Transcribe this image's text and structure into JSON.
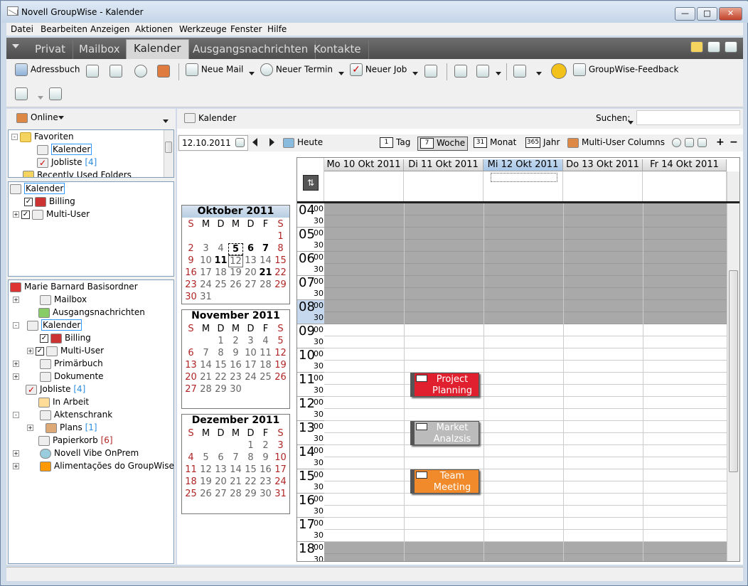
{
  "window": {
    "title": "Novell GroupWise - Kalender"
  },
  "menu": [
    "Datei",
    "Bearbeiten",
    "Anzeigen",
    "Aktionen",
    "Werkzeuge",
    "Fenster",
    "Hilfe"
  ],
  "tabs": [
    "Privat",
    "Mailbox",
    "Kalender",
    "Ausgangsnachrichten",
    "Kontakte"
  ],
  "toolbar": {
    "address_book": "Adressbuch",
    "new_mail": "Neue Mail",
    "new_appt": "Neuer Termin",
    "new_job": "Neuer Job",
    "feedback": "GroupWise-Feedback"
  },
  "left": {
    "online": "Online",
    "favorites": {
      "title": "Favoriten",
      "items": [
        {
          "label": "Kalender"
        },
        {
          "label": "Jobliste",
          "count": "[4]"
        }
      ],
      "recent": "Recently Used Folders"
    },
    "cal_list": {
      "title": "Kalender",
      "items": [
        "Billing",
        "Multi-User"
      ]
    },
    "folders": {
      "root": "Marie Barnard Basisordner",
      "items": [
        {
          "label": "Mailbox"
        },
        {
          "label": "Ausgangsnachrichten"
        },
        {
          "label": "Kalender"
        },
        {
          "label": "Billing"
        },
        {
          "label": "Multi-User"
        },
        {
          "label": "Primärbuch"
        },
        {
          "label": "Dokumente"
        },
        {
          "label": "Jobliste",
          "count": "[4]"
        },
        {
          "label": "In Arbeit"
        },
        {
          "label": "Aktenschrank"
        },
        {
          "label": "Plans",
          "count": "[1]"
        },
        {
          "label": "Papierkorb",
          "count": "[6]"
        },
        {
          "label": "Novell Vibe OnPrem"
        },
        {
          "label": "Alimentações do GroupWise"
        }
      ]
    }
  },
  "main": {
    "header": "Kalender",
    "search_label": "Suchen:",
    "date": "12.10.2011",
    "today": "Heute",
    "views": [
      "Tag",
      "Woche",
      "Monat",
      "Jahr",
      "Multi-User Columns"
    ],
    "view_icons": [
      "1",
      "7",
      "31",
      "365"
    ],
    "days": [
      "Mo 10 Okt 2011",
      "Di 11 Okt 2011",
      "Mi 12 Okt 2011",
      "Do 13 Okt 2011",
      "Fr 14 Okt 2011"
    ],
    "hours": [
      "04",
      "05",
      "06",
      "07",
      "08",
      "09",
      "10",
      "11",
      "12",
      "13",
      "14",
      "15",
      "16",
      "17",
      "18"
    ],
    "minutes": [
      "00",
      "30"
    ],
    "appointments": [
      {
        "title": "Project Planning",
        "color": "#e0202e"
      },
      {
        "title": "Market Analzsis",
        "color": "#bbbbbb"
      },
      {
        "title": "Team Meeting",
        "color": "#f08a2a"
      }
    ]
  },
  "minicals": [
    {
      "title": "Oktober 2011",
      "weekdays": [
        "S",
        "M",
        "D",
        "M",
        "D",
        "F",
        "S"
      ],
      "start": 6,
      "days": 31,
      "bold": [
        5,
        6,
        7,
        11,
        21
      ],
      "boxed": 5,
      "today": 12
    },
    {
      "title": "November 2011",
      "weekdays": [
        "S",
        "M",
        "D",
        "M",
        "D",
        "F",
        "S"
      ],
      "start": 2,
      "days": 30,
      "bold": [],
      "boxed": 0,
      "today": 0
    },
    {
      "title": "Dezember 2011",
      "weekdays": [
        "S",
        "M",
        "D",
        "M",
        "D",
        "F",
        "S"
      ],
      "start": 4,
      "days": 31,
      "bold": [],
      "boxed": 0,
      "today": 0
    }
  ]
}
